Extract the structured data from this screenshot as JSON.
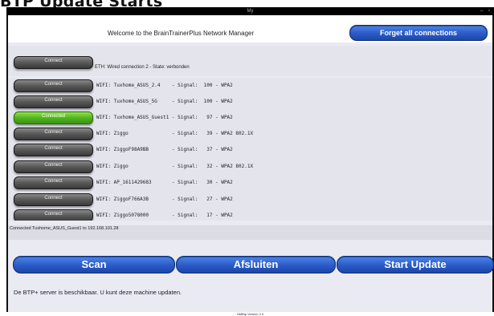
{
  "heading_fragment": "BTP Update Starts",
  "window": {
    "title": "My",
    "controls": "– ▫"
  },
  "header": {
    "welcome": "Welcome to the BrainTrainerPlus Network Manager",
    "forget_button": "Forget all connections"
  },
  "ethernet": {
    "button": "Connect",
    "label": "ETH: Wired connection 2 - State: verbonden"
  },
  "wifi_networks": [
    {
      "button": "Connect",
      "connected": false,
      "line": "WIFI: Tuxhome_ASUS_2.4    - Signal:  100 - WPA2"
    },
    {
      "button": "Connect",
      "connected": false,
      "line": "WIFI: Tuxhome_ASUS_5G     - Signal:  100 - WPA2"
    },
    {
      "button": "Connected",
      "connected": true,
      "line": "WIFI: Tuxhome_ASUS_Guest1 - Signal:   97 - WPA2"
    },
    {
      "button": "Connect",
      "connected": false,
      "line": "WIFI: Ziggo               - Signal:   39 - WPA2 802.1X"
    },
    {
      "button": "Connect",
      "connected": false,
      "line": "WIFI: ZiggoF98A9BB        - Signal:   37 - WPA2"
    },
    {
      "button": "Connect",
      "connected": false,
      "line": "WIFI: Ziggo               - Signal:   32 - WPA2 802.1X"
    },
    {
      "button": "Connect",
      "connected": false,
      "line": "WIFI: AP_1611429683       - Signal:   30 - WPA2"
    },
    {
      "button": "Connect",
      "connected": false,
      "line": "WIFI: ZiggoF766A3B        - Signal:   27 - WPA2"
    },
    {
      "button": "Connect",
      "connected": false,
      "line": "WIFI: Ziggo5078000        - Signal:   17 - WPA2"
    }
  ],
  "status": "Connected Tuxhome_ASUS_Guest1 to 192.168.101.28",
  "actions": {
    "scan": "Scan",
    "afsluiten": "Afsluiten",
    "start_update": "Start Update"
  },
  "message": "De BTP+ server is beschikbaar. U kunt deze machine updaten.",
  "version": "NMBtp Version 2.0",
  "colors": {
    "accent_blue": "#2d5ec9",
    "connected_green": "#52b41f",
    "connect_gray": "#5c5c5c"
  }
}
